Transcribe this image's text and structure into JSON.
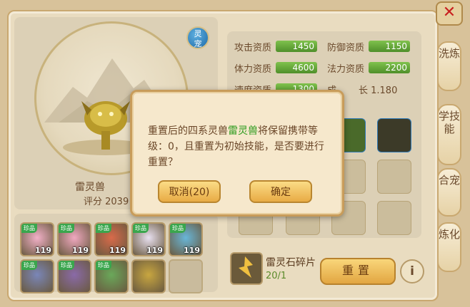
{
  "pet": {
    "badge_line1": "灵",
    "badge_line2": "宠",
    "name": "雷灵兽",
    "score": "评分 2039"
  },
  "stats": [
    {
      "label": "攻击资质",
      "value": "1450"
    },
    {
      "label": "防御资质",
      "value": "1150"
    },
    {
      "label": "体力资质",
      "value": "4600"
    },
    {
      "label": "法力资质",
      "value": "2200"
    },
    {
      "label": "速度资质",
      "value": "1300"
    },
    {
      "label": "成",
      "value": ""
    }
  ],
  "growth_value": "长 1.180",
  "pet_grid": [
    {
      "badge": "珍品",
      "level": "119",
      "color": "#f2b0c8"
    },
    {
      "badge": "珍品",
      "level": "119",
      "color": "#f0a8c0"
    },
    {
      "badge": "珍品",
      "level": "119",
      "color": "#d86a4a"
    },
    {
      "badge": "珍品",
      "level": "119",
      "color": "#e8e0f0"
    },
    {
      "badge": "珍品",
      "level": "119",
      "color": "#68b6d8"
    },
    {
      "badge": "珍品",
      "level": "",
      "color": "#7a86b8"
    },
    {
      "badge": "珍品",
      "level": "",
      "color": "#8a6aa8"
    },
    {
      "badge": "珍品",
      "level": "",
      "color": "#6aa85a"
    },
    {
      "badge": "",
      "level": "",
      "color": "#c8a640"
    }
  ],
  "tabs": [
    "洗炼",
    "学技能",
    "合宠",
    "炼化"
  ],
  "close_label": "✕",
  "shard": {
    "name": "雷灵石碎片",
    "count": "20/1"
  },
  "reset_label": "重置",
  "info_label": "i",
  "dialog": {
    "text_before": "重置后的四系灵兽",
    "highlight": "雷灵兽",
    "text_after": "将保留携带等级：0，且重置为初始技能，是否要进行重置？",
    "cancel_label": "取消(20)",
    "confirm_label": "确定"
  }
}
